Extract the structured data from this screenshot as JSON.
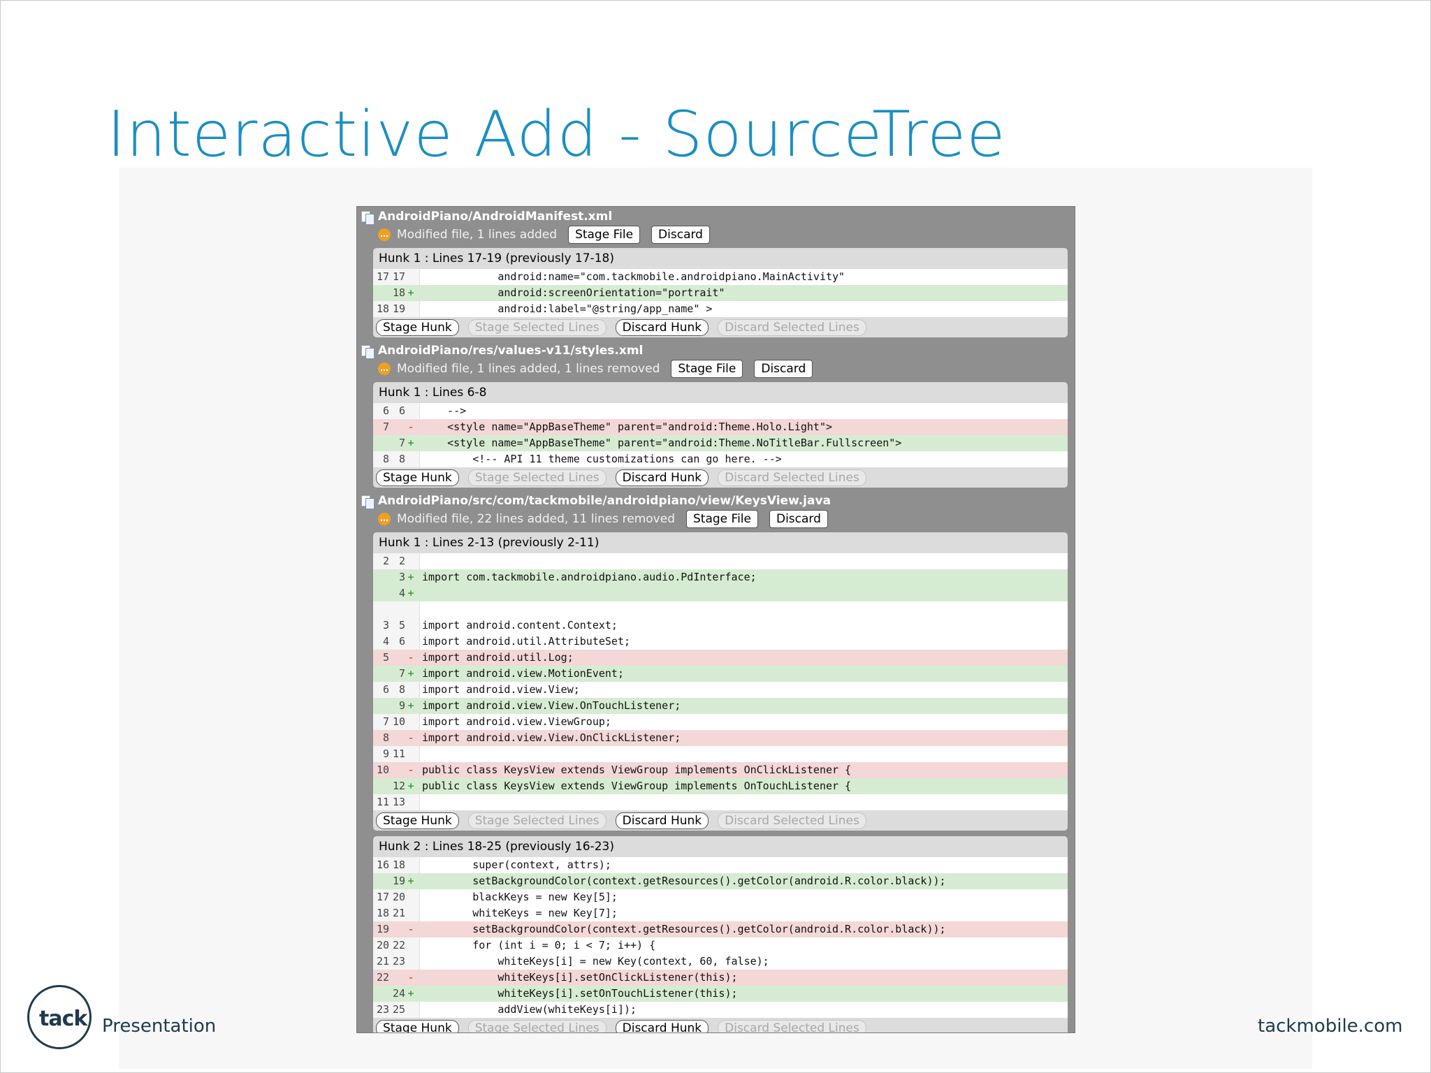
{
  "slide_title": "Interactive Add - SourceTree",
  "footer": {
    "logo_text": "tack",
    "left": "Presentation",
    "right": "tackmobile.com"
  },
  "buttons": {
    "stage_file": "Stage File",
    "discard": "Discard",
    "stage_hunk": "Stage Hunk",
    "stage_selected": "Stage Selected Lines",
    "discard_hunk": "Discard Hunk",
    "discard_selected": "Discard Selected Lines"
  },
  "files": [
    {
      "path": "AndroidPiano/AndroidManifest.xml",
      "status": "Modified file, 1 lines added",
      "hunks": [
        {
          "title": "Hunk 1 : Lines 17-19 (previously 17-18)",
          "lines": [
            {
              "t": "ctx",
              "o": "17",
              "n": "17",
              "s": "",
              "c": "            android:name=\"com.tackmobile.androidpiano.MainActivity\""
            },
            {
              "t": "add",
              "o": "",
              "n": "18",
              "s": "+",
              "c": "            android:screenOrientation=\"portrait\""
            },
            {
              "t": "ctx",
              "o": "18",
              "n": "19",
              "s": "",
              "c": "            android:label=\"@string/app_name\" >"
            }
          ]
        }
      ]
    },
    {
      "path": "AndroidPiano/res/values-v11/styles.xml",
      "status": "Modified file, 1 lines added, 1 lines removed",
      "hunks": [
        {
          "title": "Hunk 1 : Lines 6-8",
          "lines": [
            {
              "t": "ctx",
              "o": "6",
              "n": "6",
              "s": "",
              "c": "    -->"
            },
            {
              "t": "rem",
              "o": "7",
              "n": "",
              "s": "-",
              "c": "    <style name=\"AppBaseTheme\" parent=\"android:Theme.Holo.Light\">"
            },
            {
              "t": "add",
              "o": "",
              "n": "7",
              "s": "+",
              "c": "    <style name=\"AppBaseTheme\" parent=\"android:Theme.NoTitleBar.Fullscreen\">"
            },
            {
              "t": "ctx",
              "o": "8",
              "n": "8",
              "s": "",
              "c": "        <!-- API 11 theme customizations can go here. -->"
            }
          ]
        }
      ]
    },
    {
      "path": "AndroidPiano/src/com/tackmobile/androidpiano/view/KeysView.java",
      "status": "Modified file, 22 lines added, 11 lines removed",
      "hunks": [
        {
          "title": "Hunk 1 : Lines 2-13 (previously 2-11)",
          "lines": [
            {
              "t": "ctx",
              "o": "2",
              "n": "2",
              "s": "",
              "c": ""
            },
            {
              "t": "add",
              "o": "",
              "n": "3",
              "s": "+",
              "c": "import com.tackmobile.androidpiano.audio.PdInterface;"
            },
            {
              "t": "add",
              "o": "",
              "n": "4",
              "s": "+",
              "c": ""
            },
            {
              "t": "ctx",
              "o": "",
              "n": "",
              "s": "",
              "c": ""
            },
            {
              "t": "ctx",
              "o": "3",
              "n": "5",
              "s": "",
              "c": "import android.content.Context;"
            },
            {
              "t": "ctx",
              "o": "4",
              "n": "6",
              "s": "",
              "c": "import android.util.AttributeSet;"
            },
            {
              "t": "rem",
              "o": "5",
              "n": "",
              "s": "-",
              "c": "import android.util.Log;"
            },
            {
              "t": "add",
              "o": "",
              "n": "7",
              "s": "+",
              "c": "import android.view.MotionEvent;"
            },
            {
              "t": "ctx",
              "o": "6",
              "n": "8",
              "s": "",
              "c": "import android.view.View;"
            },
            {
              "t": "add",
              "o": "",
              "n": "9",
              "s": "+",
              "c": "import android.view.View.OnTouchListener;"
            },
            {
              "t": "ctx",
              "o": "7",
              "n": "10",
              "s": "",
              "c": "import android.view.ViewGroup;"
            },
            {
              "t": "rem",
              "o": "8",
              "n": "",
              "s": "-",
              "c": "import android.view.View.OnClickListener;"
            },
            {
              "t": "ctx",
              "o": "9",
              "n": "11",
              "s": "",
              "c": ""
            },
            {
              "t": "rem",
              "o": "10",
              "n": "",
              "s": "-",
              "c": "public class KeysView extends ViewGroup implements OnClickListener {"
            },
            {
              "t": "add",
              "o": "",
              "n": "12",
              "s": "+",
              "c": "public class KeysView extends ViewGroup implements OnTouchListener {"
            },
            {
              "t": "ctx",
              "o": "11",
              "n": "13",
              "s": "",
              "c": ""
            }
          ]
        },
        {
          "title": "Hunk 2 : Lines 18-25 (previously 16-23)",
          "lines": [
            {
              "t": "ctx",
              "o": "16",
              "n": "18",
              "s": "",
              "c": "        super(context, attrs);"
            },
            {
              "t": "add",
              "o": "",
              "n": "19",
              "s": "+",
              "c": "        setBackgroundColor(context.getResources().getColor(android.R.color.black));"
            },
            {
              "t": "ctx",
              "o": "17",
              "n": "20",
              "s": "",
              "c": "        blackKeys = new Key[5];"
            },
            {
              "t": "ctx",
              "o": "18",
              "n": "21",
              "s": "",
              "c": "        whiteKeys = new Key[7];"
            },
            {
              "t": "rem",
              "o": "19",
              "n": "",
              "s": "-",
              "c": "        setBackgroundColor(context.getResources().getColor(android.R.color.black));"
            },
            {
              "t": "ctx",
              "o": "20",
              "n": "22",
              "s": "",
              "c": "        for (int i = 0; i < 7; i++) {"
            },
            {
              "t": "ctx",
              "o": "21",
              "n": "23",
              "s": "",
              "c": "            whiteKeys[i] = new Key(context, 60, false);"
            },
            {
              "t": "rem",
              "o": "22",
              "n": "",
              "s": "-",
              "c": "            whiteKeys[i].setOnClickListener(this);"
            },
            {
              "t": "add",
              "o": "",
              "n": "24",
              "s": "+",
              "c": "            whiteKeys[i].setOnTouchListener(this);"
            },
            {
              "t": "ctx",
              "o": "23",
              "n": "25",
              "s": "",
              "c": "            addView(whiteKeys[i]);"
            }
          ]
        }
      ]
    }
  ]
}
